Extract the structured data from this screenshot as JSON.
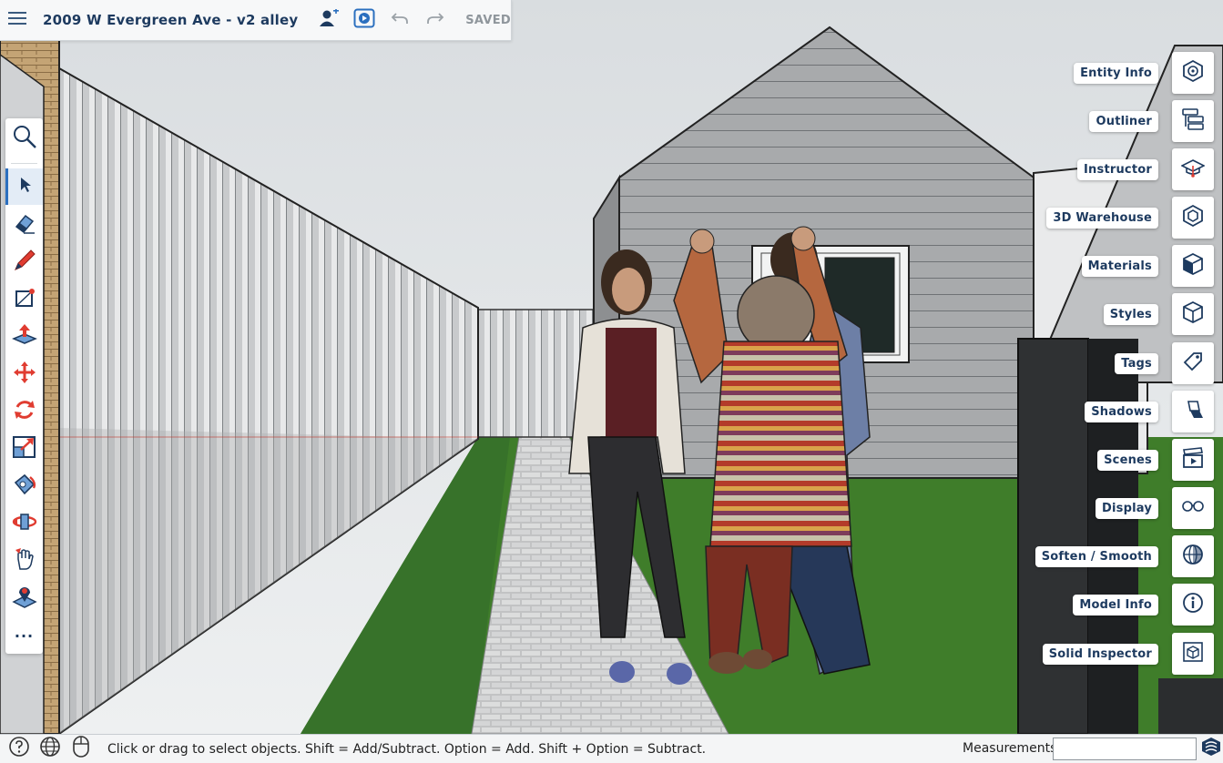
{
  "header": {
    "menu_icon": "hamburger-menu-icon",
    "title": "2009 W Evergreen Ave - v2 alley",
    "share_icon": "add-person-icon",
    "present_icon": "play-presentation-icon",
    "undo_icon": "undo-icon",
    "redo_icon": "redo-icon",
    "save_status": "SAVED"
  },
  "toolbar": {
    "tools": [
      {
        "name": "search",
        "icon": "search-icon"
      },
      {
        "name": "select",
        "icon": "select-arrow-icon",
        "active": true
      },
      {
        "name": "eraser",
        "icon": "eraser-icon"
      },
      {
        "name": "pencil",
        "icon": "pencil-icon"
      },
      {
        "name": "rectangle",
        "icon": "rectangle-icon"
      },
      {
        "name": "push-pull",
        "icon": "push-pull-icon"
      },
      {
        "name": "move",
        "icon": "move-icon"
      },
      {
        "name": "rotate",
        "icon": "rotate-icon"
      },
      {
        "name": "scale",
        "icon": "scale-icon"
      },
      {
        "name": "paint",
        "icon": "paint-bucket-icon"
      },
      {
        "name": "orbit",
        "icon": "orbit-icon"
      },
      {
        "name": "pan",
        "icon": "pan-hand-icon"
      },
      {
        "name": "position-camera",
        "icon": "position-camera-icon"
      },
      {
        "name": "more",
        "icon": "more-dots-icon",
        "label": "···"
      }
    ]
  },
  "panels": [
    {
      "label": "Entity Info",
      "icon": "entity-info-icon"
    },
    {
      "label": "Outliner",
      "icon": "outliner-icon"
    },
    {
      "label": "Instructor",
      "icon": "graduation-cap-icon"
    },
    {
      "label": "3D Warehouse",
      "icon": "warehouse-icon"
    },
    {
      "label": "Materials",
      "icon": "materials-cube-icon"
    },
    {
      "label": "Styles",
      "icon": "styles-cube-icon"
    },
    {
      "label": "Tags",
      "icon": "tag-icon"
    },
    {
      "label": "Shadows",
      "icon": "shadows-icon"
    },
    {
      "label": "Scenes",
      "icon": "clapperboard-icon"
    },
    {
      "label": "Display",
      "icon": "glasses-icon"
    },
    {
      "label": "Soften / Smooth",
      "icon": "sphere-icon"
    },
    {
      "label": "Model Info",
      "icon": "info-icon"
    },
    {
      "label": "Solid Inspector",
      "icon": "solid-inspector-icon"
    }
  ],
  "statusbar": {
    "help_icon": "help-icon",
    "globe_icon": "globe-icon",
    "mouse_icon": "mouse-icon",
    "hint": "Click or drag to select objects. Shift = Add/Subtract. Option = Add. Shift + Option = Subtract.",
    "measurements_label": "Measurements",
    "measurements_value": "",
    "logo_icon": "sketchup-logo-icon"
  },
  "colors": {
    "accent": "#2b6fbf",
    "title_text": "#1d3a5f",
    "grass": "#3f7d2a",
    "siding": "#a9abad",
    "sky": "#e7eaec"
  }
}
